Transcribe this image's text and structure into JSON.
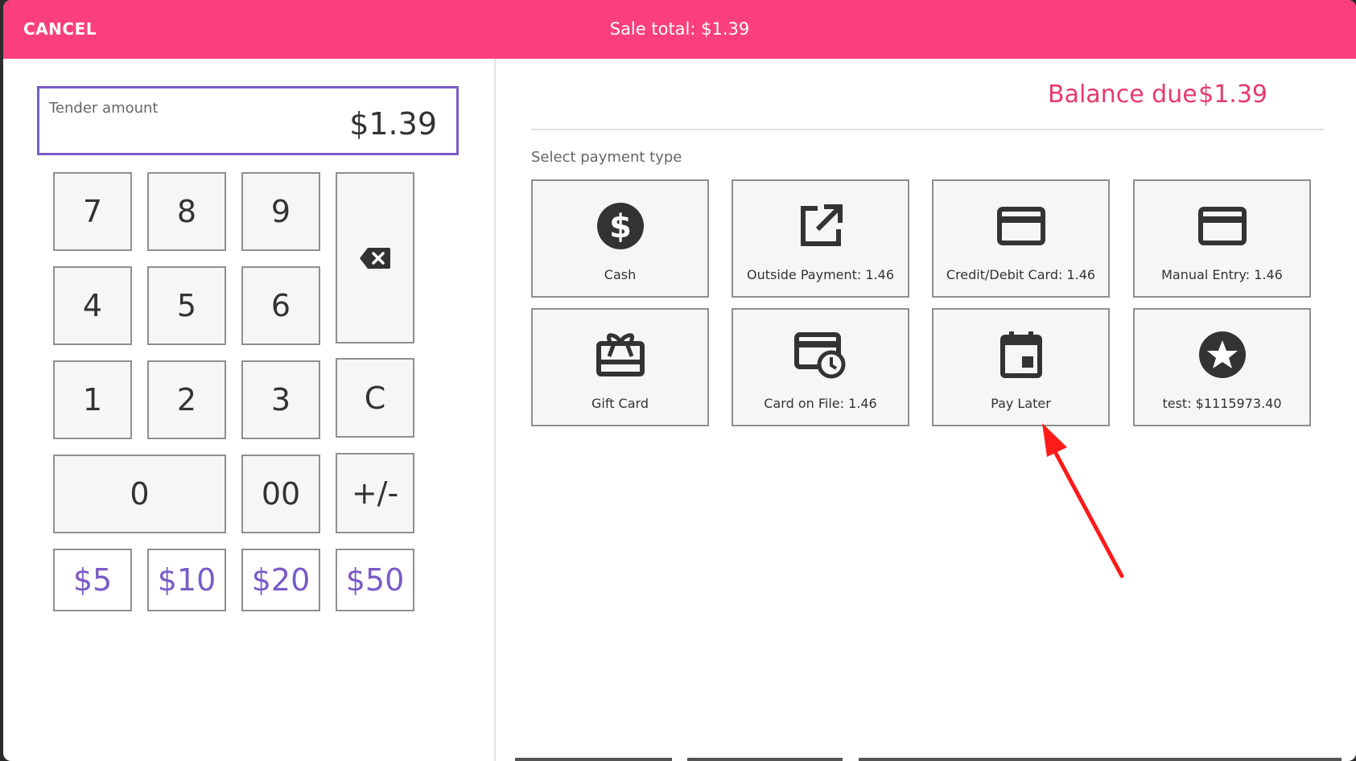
{
  "header": {
    "cancel_label": "CANCEL",
    "sale_total": "Sale total: $1.39"
  },
  "tender": {
    "label": "Tender amount",
    "value": "$1.39"
  },
  "keypad": {
    "k7": "7",
    "k8": "8",
    "k9": "9",
    "k4": "4",
    "k5": "5",
    "k6": "6",
    "k1": "1",
    "k2": "2",
    "k3": "3",
    "clear": "C",
    "k0": "0",
    "k00": "00",
    "sign": "+/-",
    "quick5": "$5",
    "quick10": "$10",
    "quick20": "$20",
    "quick50": "$50"
  },
  "balance": {
    "label": "Balance due",
    "value": "$1.39"
  },
  "payment": {
    "section_label": "Select payment type",
    "types": [
      {
        "label": "Cash",
        "icon": "dollar-circle-icon"
      },
      {
        "label": "Outside Payment: 1.46",
        "icon": "open-external-icon"
      },
      {
        "label": "Credit/Debit Card: 1.46",
        "icon": "credit-card-icon"
      },
      {
        "label": "Manual Entry: 1.46",
        "icon": "credit-card-icon"
      },
      {
        "label": "Gift Card",
        "icon": "gift-card-icon"
      },
      {
        "label": "Card on File: 1.46",
        "icon": "card-clock-icon"
      },
      {
        "label": "Pay Later",
        "icon": "calendar-icon"
      },
      {
        "label": "test: $1115973.40",
        "icon": "star-circle-icon"
      }
    ]
  },
  "colors": {
    "header_bg": "#fb3f7d",
    "balance_text": "#e8396b",
    "accent_purple": "#7a5bc7",
    "annotation_arrow": "#ff0000"
  }
}
